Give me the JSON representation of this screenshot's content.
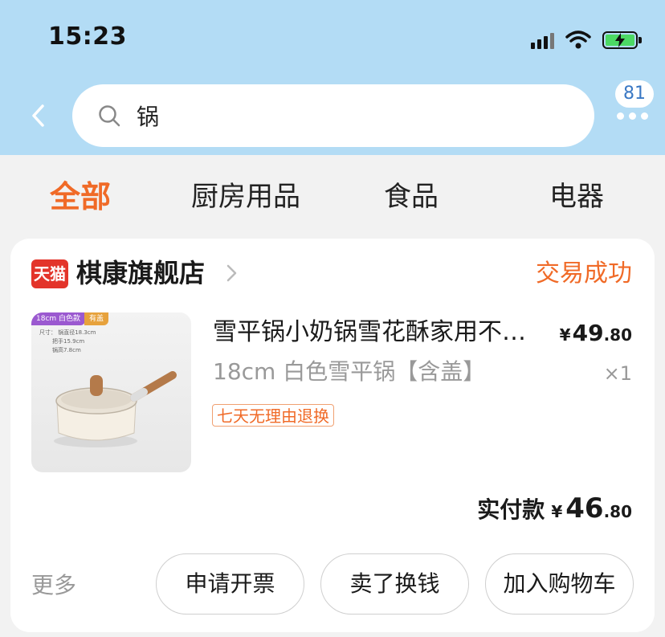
{
  "status_bar": {
    "time": "15:23",
    "icons": [
      "cellular-signal-icon",
      "wifi-icon",
      "battery-charging-icon"
    ]
  },
  "header": {
    "back_icon": "chevron-left-icon",
    "search": {
      "icon": "search-icon",
      "query": "锅"
    },
    "more": {
      "badge_count": "81",
      "icon": "more-dots-icon"
    }
  },
  "tabs": [
    {
      "label": "全部",
      "active": true
    },
    {
      "label": "厨房用品",
      "active": false
    },
    {
      "label": "食品",
      "active": false
    },
    {
      "label": "电器",
      "active": false
    }
  ],
  "order": {
    "shop": {
      "logo_text": "天猫",
      "name": "棋康旗舰店",
      "chevron_icon": "chevron-right-icon"
    },
    "status": "交易成功",
    "product": {
      "image_tags": [
        "18cm 白色款",
        "有盖"
      ],
      "image_spec_lines": [
        "尺寸： 锅直径18.3cm",
        "把手15.9cm",
        "锅高7.8cm"
      ],
      "title": "雪平锅小奶锅雪花酥家用不粘锅",
      "price": {
        "currency": "¥",
        "integer": "49",
        "decimal": ".80"
      },
      "variant": "18cm 白色雪平锅【含盖】",
      "quantity": "×1",
      "service_tag": "七天无理由退换"
    },
    "payment": {
      "label": "实付款",
      "currency": "¥",
      "integer": "46",
      "decimal": ".80"
    },
    "more_label": "更多",
    "actions": [
      "申请开票",
      "卖了换钱",
      "加入购物车"
    ]
  },
  "colors": {
    "header_bg": "#b3dcf5",
    "accent": "#f06a27",
    "tmall_red": "#e3342a",
    "page_bg": "#f2f2f2"
  }
}
